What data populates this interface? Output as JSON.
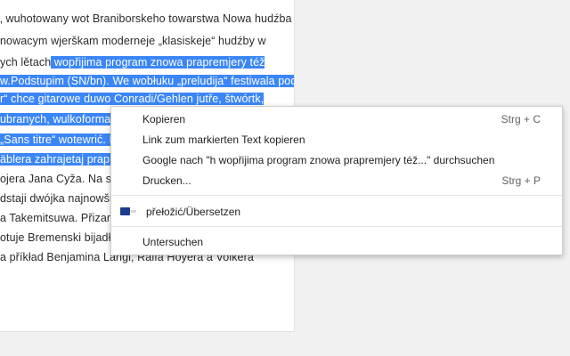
{
  "article": {
    "lines": [
      [
        {
          "t": "‚ wuhotowany wot Braniborskeho towarstwa Nowa hudźba",
          "s": false
        }
      ],
      [
        {
          "t": "nowacym wjerškam moderneje „klasiskeje“ hudźby w",
          "s": false
        }
      ],
      [
        {
          "t": "ych lětach",
          "s": false
        },
        {
          "t": " wopřijima program znowa prapremjery též",
          "s": true
        }
      ],
      [
        {
          "t": "w.Podstupim (SN/bn). We wobłuku „preludija“ festiwala pod",
          "s": true
        }
      ],
      [
        {
          "t": "r“ chce gitarowe duwo Conradi/Gehlen jutře, štwórtk,",
          "s": true
        }
      ],
      [
        {
          "t": "ubranych, wulkoformatnych",
          "s": true
        },
        {
          "t": " ",
          "s": false
        }
      ],
      [
        {
          "t": "„Sans titre“ wotewrić. N",
          "s": true
        }
      ],
      [
        {
          "t": "äblera zahrajetaj prapre",
          "s": true
        }
      ],
      [
        {
          "t": "ojera Jana Cyža. Na slě",
          "s": false
        }
      ],
      [
        {
          "t": "dstaji dwójka najnowši k",
          "s": false
        }
      ],
      [
        {
          "t": "a Takemitsuwa. Přizam",
          "s": false
        }
      ],
      [
        {
          "t": "otuje Bremenski bijadło",
          "s": false
        }
      ],
      [
        {
          "t": "a příkład Benjamina Langi, Ralfa Hoyera a Volkera",
          "s": false
        }
      ]
    ]
  },
  "context_menu": {
    "copy": {
      "label": "Kopieren",
      "shortcut": "Strg + C"
    },
    "copy_link": {
      "label": "Link zum markierten Text kopieren"
    },
    "google_search": {
      "label": "Google nach \"h wopřijima program znowa prapremjery též...\" durchsuchen"
    },
    "print": {
      "label": "Drucken...",
      "shortcut": "Strg + P"
    },
    "translate": {
      "label": "přełožić/Übersetzen",
      "icon": "translator-extension-icon"
    },
    "inspect": {
      "label": "Untersuchen"
    }
  },
  "colors": {
    "selection": "#3b86f7",
    "text": "#2b2b2b",
    "background": "#f1f1f1"
  }
}
